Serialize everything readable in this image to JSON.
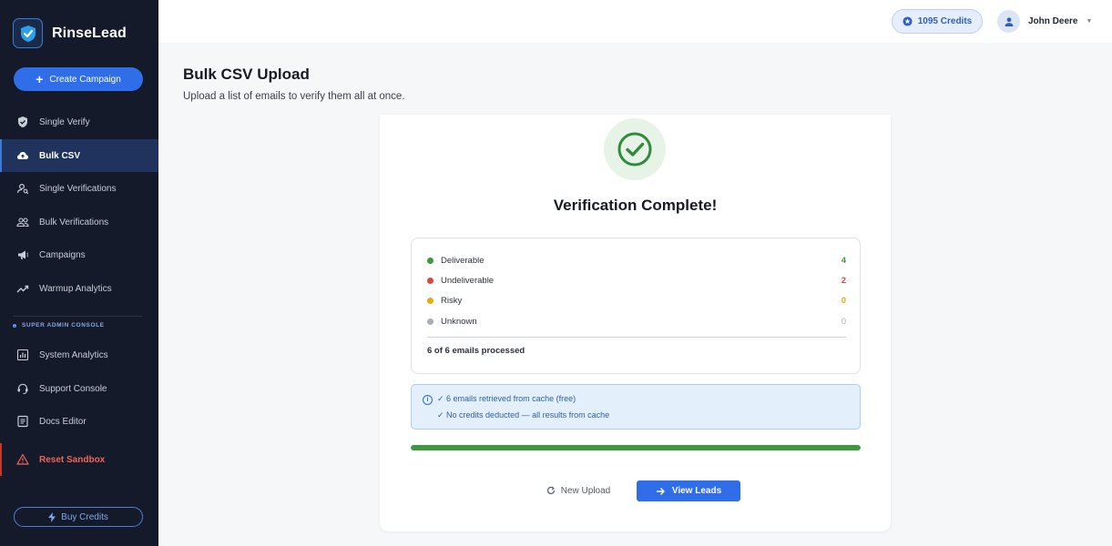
{
  "brand": {
    "name": "RinseLead"
  },
  "sidebar": {
    "create_label": "Create Campaign",
    "items": [
      {
        "label": "Single Verify",
        "icon": "shield-check-icon"
      },
      {
        "label": "Bulk CSV",
        "icon": "cloud-upload-icon",
        "active": true
      },
      {
        "label": "Single Verifications",
        "icon": "person-search-icon"
      },
      {
        "label": "Bulk Verifications",
        "icon": "people-icon"
      },
      {
        "label": "Campaigns",
        "icon": "megaphone-icon"
      },
      {
        "label": "Warmup Analytics",
        "icon": "trending-up-icon"
      }
    ],
    "section_label": "SUPER ADMIN CONSOLE",
    "admin_items": [
      {
        "label": "System Analytics",
        "icon": "bar-chart-icon"
      },
      {
        "label": "Support Console",
        "icon": "headset-icon"
      },
      {
        "label": "Docs Editor",
        "icon": "document-icon"
      }
    ],
    "reset_label": "Reset Sandbox",
    "buy_label": "Buy Credits"
  },
  "topbar": {
    "credits_label": "1095 Credits",
    "user_name": "John Deere"
  },
  "page": {
    "title": "Bulk CSV Upload",
    "subtitle": "Upload a list of emails to verify them all at once."
  },
  "result": {
    "title": "Verification Complete!",
    "rows": [
      {
        "label": "Deliverable",
        "count": "4",
        "color": "#3c9a3c"
      },
      {
        "label": "Undeliverable",
        "count": "2",
        "color": "#e0443e"
      },
      {
        "label": "Risky",
        "count": "0",
        "color": "#f0a800"
      },
      {
        "label": "Unknown",
        "count": "0",
        "color": "#a9adb5"
      }
    ],
    "processed": "6 of 6 emails processed",
    "info_lines": [
      "✓ 6 emails retrieved from cache (free)",
      "✓ No credits deducted — all results from cache"
    ],
    "progress": 1.0,
    "new_upload_label": "New Upload",
    "view_leads_label": "View Leads"
  },
  "colors": {
    "accent": "#2f6ee8",
    "sidebar_bg": "#141a2a",
    "success": "#3c9a3c",
    "danger": "#e0443e"
  }
}
